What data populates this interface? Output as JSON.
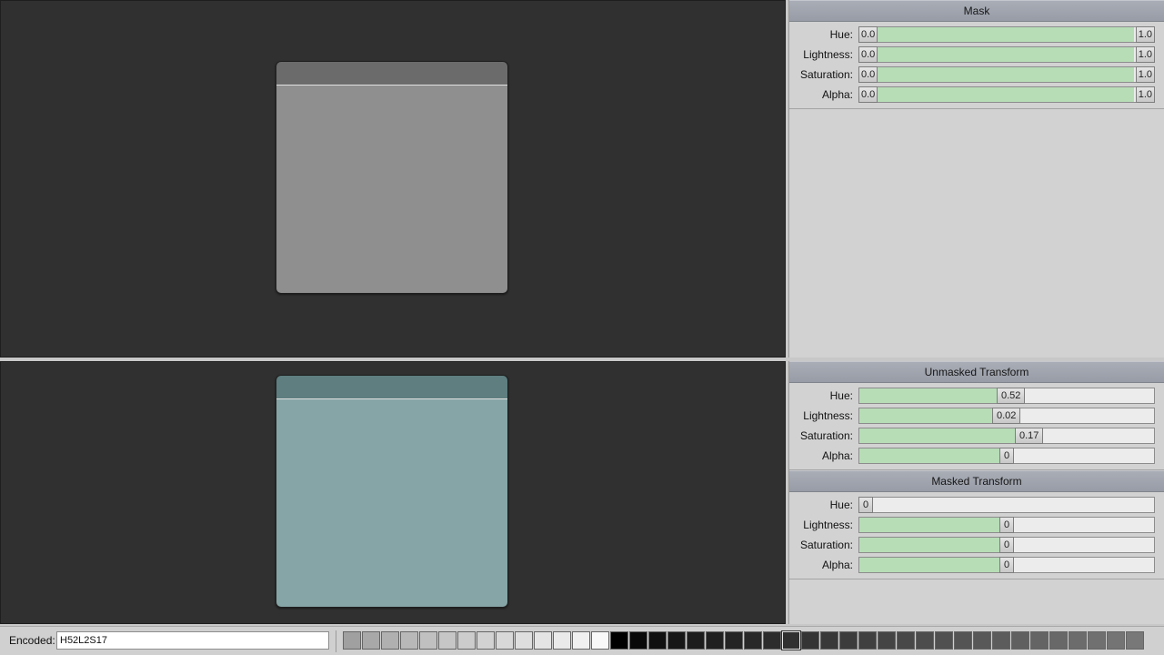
{
  "mask": {
    "title": "Mask",
    "sliders": [
      {
        "label": "Hue:",
        "low": "0.0",
        "high": "1.0"
      },
      {
        "label": "Lightness:",
        "low": "0.0",
        "high": "1.0"
      },
      {
        "label": "Saturation:",
        "low": "0.0",
        "high": "1.0"
      },
      {
        "label": "Alpha:",
        "low": "0.0",
        "high": "1.0"
      }
    ]
  },
  "unmasked": {
    "title": "Unmasked Transform",
    "sliders": [
      {
        "label": "Hue:",
        "value": "0.52",
        "fraction": 0.47
      },
      {
        "label": "Lightness:",
        "value": "0.02",
        "fraction": 0.455
      },
      {
        "label": "Saturation:",
        "value": "0.17",
        "fraction": 0.53
      },
      {
        "label": "Alpha:",
        "value": "0",
        "fraction": 0.477
      }
    ]
  },
  "masked": {
    "title": "Masked Transform",
    "sliders": [
      {
        "label": "Hue:",
        "value": "0",
        "fraction": 0.0
      },
      {
        "label": "Lightness:",
        "value": "0",
        "fraction": 0.477
      },
      {
        "label": "Saturation:",
        "value": "0",
        "fraction": 0.477
      },
      {
        "label": "Alpha:",
        "value": "0",
        "fraction": 0.477
      }
    ]
  },
  "encoded": {
    "label": "Encoded:",
    "value": "H52L2S17"
  },
  "colors": {
    "viewport_bg": "#303030",
    "source_title": "#6b6b6b",
    "source_body": "#8f8f8f",
    "result_title": "#5e7e80",
    "result_body": "#86a5a6",
    "slider_fill": "#b7ddb7"
  },
  "swatches": [
    "#a0a0a0",
    "#a8a8a8",
    "#b0b0b0",
    "#b8b8b8",
    "#c0c0c0",
    "#c6c6c6",
    "#cccccc",
    "#d2d2d2",
    "#d8d8d8",
    "#dedede",
    "#e4e4e4",
    "#eaeaea",
    "#f0f0f0",
    "#f8f8f8",
    "#000000",
    "#080808",
    "#101010",
    "#161616",
    "#1c1c1c",
    "#202020",
    "#242424",
    "#282828",
    "#2c2c2c",
    "#303030",
    "#343434",
    "#383838",
    "#3c3c3c",
    "#404040",
    "#444444",
    "#484848",
    "#4c4c4c",
    "#505050",
    "#545454",
    "#585858",
    "#5c5c5c",
    "#606060",
    "#646464",
    "#686868",
    "#6c6c6c",
    "#707070",
    "#747474",
    "#787878"
  ],
  "selected_swatch": 23
}
